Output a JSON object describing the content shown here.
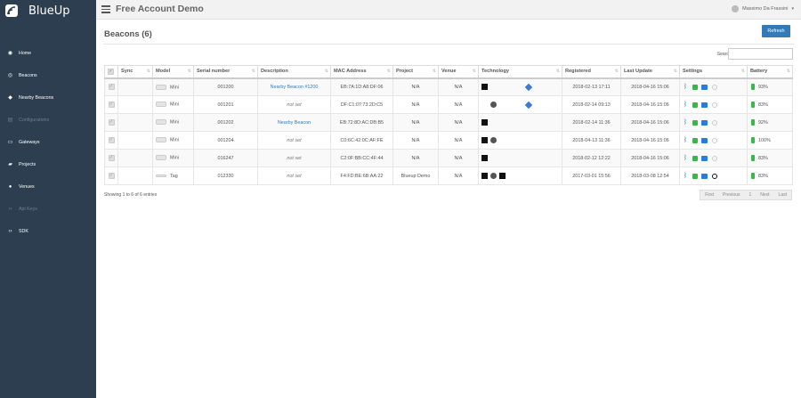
{
  "app": {
    "name": "BlueUp",
    "title": "Free Account Demo",
    "user": "Massimo Da Frassini"
  },
  "nav": [
    {
      "label": "Home",
      "icon": "gauge-icon",
      "disabled": false
    },
    {
      "label": "Beacons",
      "icon": "beacon-icon",
      "disabled": false
    },
    {
      "label": "Nearby Beacons",
      "icon": "nearby-icon",
      "disabled": false
    },
    {
      "label": "Configurations",
      "icon": "config-icon",
      "disabled": true
    },
    {
      "label": "Gateways",
      "icon": "laptop-icon",
      "disabled": false
    },
    {
      "label": "Projects",
      "icon": "folder-icon",
      "disabled": false
    },
    {
      "label": "Venues",
      "icon": "pin-icon",
      "disabled": false
    },
    {
      "label": "Api Keys",
      "icon": "code-icon",
      "disabled": true
    },
    {
      "label": "SDK",
      "icon": "code-icon",
      "disabled": false
    }
  ],
  "page": {
    "title": "Beacons (6)",
    "refresh_label": "Refresh",
    "search_label": "Search:"
  },
  "columns": [
    "Sync",
    "Model",
    "Serial number",
    "Description",
    "MAC Address",
    "Project",
    "Venue",
    "Technology",
    "Registered",
    "Last Update",
    "Settings",
    "Battery"
  ],
  "rows": [
    {
      "model": "Mini",
      "serial": "001200",
      "description": "Nearby Beacon #1200",
      "desc_link": true,
      "mac": "EB:7A:1D:A8:DF:06",
      "project": "N/A",
      "venue": "N/A",
      "tech": [
        "black",
        "",
        "diamond"
      ],
      "registered": "2018-02-13 17:11",
      "updated": "2018-04-16 15:06",
      "last_icon": "circle",
      "battery": "93%"
    },
    {
      "model": "Mini",
      "serial": "001201",
      "description": "not set",
      "desc_link": false,
      "mac": "DF:C1:07:73:2D:C5",
      "project": "N/A",
      "venue": "N/A",
      "tech": [
        "",
        "round",
        "diamond"
      ],
      "registered": "2018-02-14 09:13",
      "updated": "2018-04-16 15:06",
      "last_icon": "circle",
      "battery": "83%"
    },
    {
      "model": "Mini",
      "serial": "001202",
      "description": "Nearby Beacon",
      "desc_link": true,
      "mac": "EB:72:8D:AC:DB:B5",
      "project": "N/A",
      "venue": "N/A",
      "tech": [
        "black"
      ],
      "registered": "2018-02-14 11:36",
      "updated": "2018-04-16 15:06",
      "last_icon": "circle",
      "battery": "92%"
    },
    {
      "model": "Mini",
      "serial": "001204",
      "description": "not set",
      "desc_link": false,
      "mac": "C0:6C:42:0C:AF:FE",
      "project": "N/A",
      "venue": "N/A",
      "tech": [
        "black",
        "round"
      ],
      "registered": "2018-04-13 11:36",
      "updated": "2018-04-16 15:06",
      "last_icon": "circle",
      "battery": "100%"
    },
    {
      "model": "Mini",
      "serial": "016247",
      "description": "not set",
      "desc_link": false,
      "mac": "C2:0F:BB:CC:4F:44",
      "project": "N/A",
      "venue": "N/A",
      "tech": [
        "black"
      ],
      "registered": "2018-02-12 12:22",
      "updated": "2018-04-16 15:06",
      "last_icon": "circle",
      "battery": "83%"
    },
    {
      "model": "Tag",
      "serial": "012330",
      "description": "not set",
      "desc_link": false,
      "mac": "F4:FD:BE:6B:AA:22",
      "project": "Blueup Demo",
      "venue": "N/A",
      "tech": [
        "black",
        "round",
        "box"
      ],
      "registered": "2017-03-01 15:56",
      "updated": "2018-03-08 12:54",
      "last_icon": "dark",
      "battery": "83%"
    }
  ],
  "footer": {
    "info": "Showing 1 to 6 of 6 entries",
    "pager": [
      "First",
      "Previous",
      "1",
      "Next",
      "Last"
    ]
  }
}
